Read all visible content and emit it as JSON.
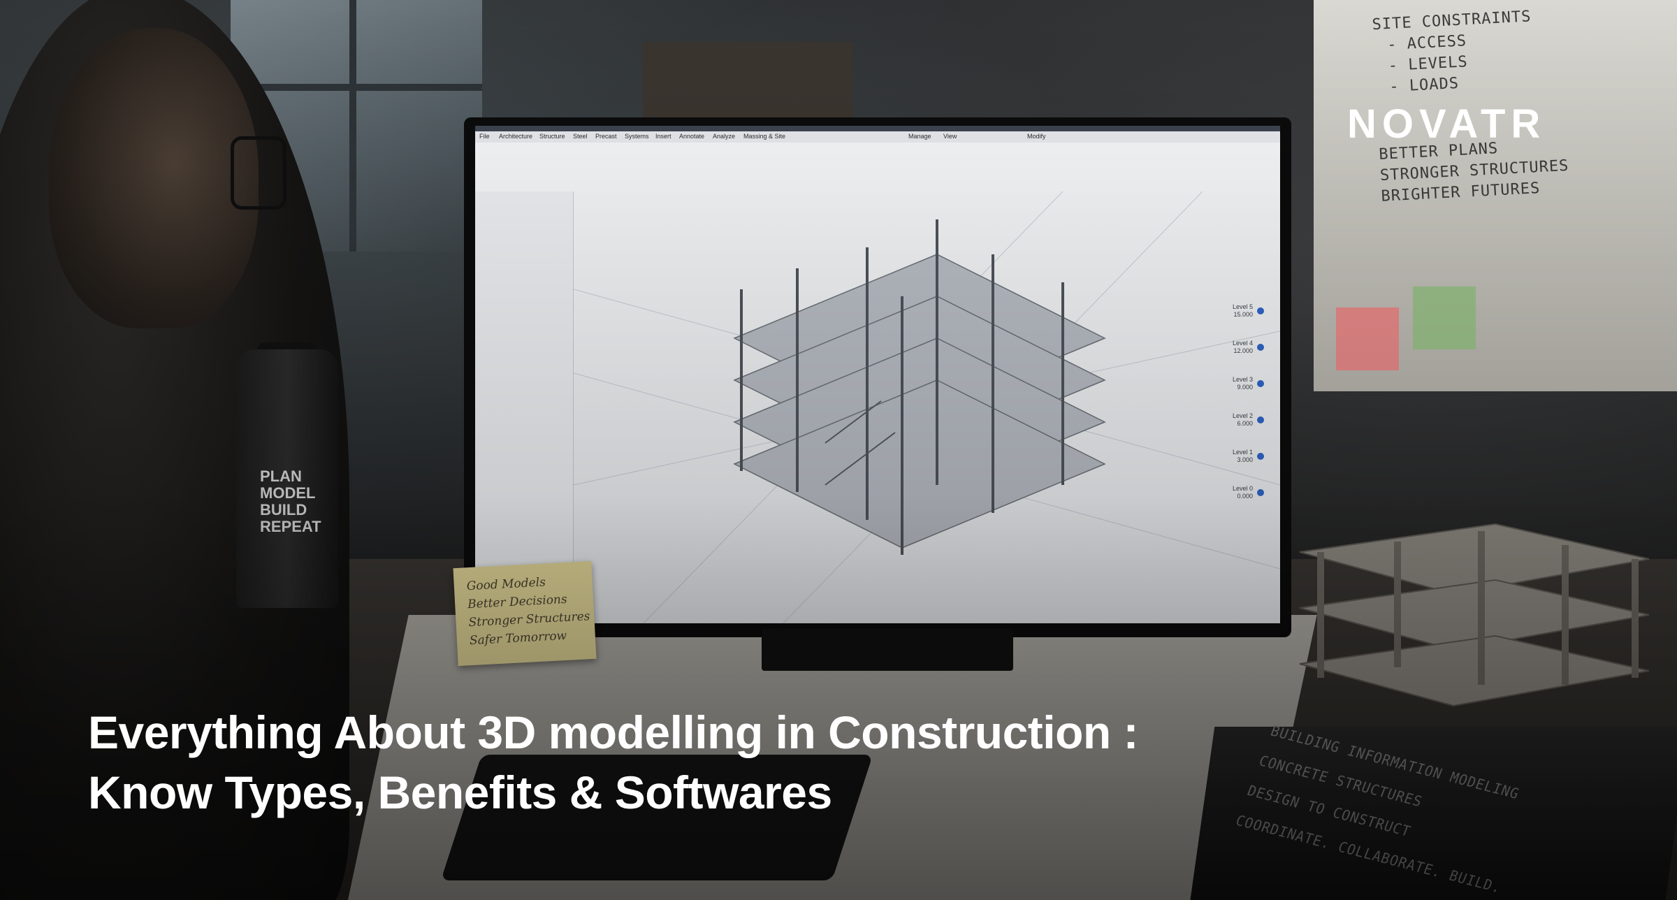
{
  "brand": {
    "logo_text": "NOVATR"
  },
  "headline": {
    "line1": "Everything About 3D modelling in Construction :",
    "line2": "Know Types, Benefits & Softwares"
  },
  "whiteboard": {
    "lines": [
      "SITE CONSTRAINTS",
      "- ACCESS",
      "- LEVELS",
      "- LOADS",
      "BETTER PLANS",
      "STRONGER STRUCTURES",
      "BRIGHTER FUTURES"
    ]
  },
  "bottle": {
    "lines": [
      "PLAN",
      "MODEL",
      "BUILD",
      "REPEAT"
    ]
  },
  "sticky_note": {
    "lines": [
      "Good Models",
      "Better Decisions",
      "Stronger Structures",
      "Safer Tomorrow"
    ]
  },
  "books": {
    "lines": [
      "BUILDING INFORMATION MODELING",
      "CONCRETE STRUCTURES",
      "DESIGN TO CONSTRUCT",
      "COORDINATE. COLLABORATE. BUILD."
    ]
  },
  "software": {
    "menu": [
      "File",
      "Architecture",
      "Structure",
      "Steel",
      "Precast",
      "Systems",
      "Insert",
      "Annotate",
      "Analyze",
      "Massing & Site",
      "Manage",
      "View",
      "Modify"
    ],
    "levels": [
      {
        "name": "Level 5",
        "value": "15.000"
      },
      {
        "name": "Level 4",
        "value": "12.000"
      },
      {
        "name": "Level 3",
        "value": "9.000"
      },
      {
        "name": "Level 2",
        "value": "6.000"
      },
      {
        "name": "Level 1",
        "value": "3.000"
      },
      {
        "name": "Level 0",
        "value": "0.000"
      }
    ]
  },
  "colors": {
    "accent_blue": "#2f66c9",
    "headline_text": "#ffffff"
  }
}
